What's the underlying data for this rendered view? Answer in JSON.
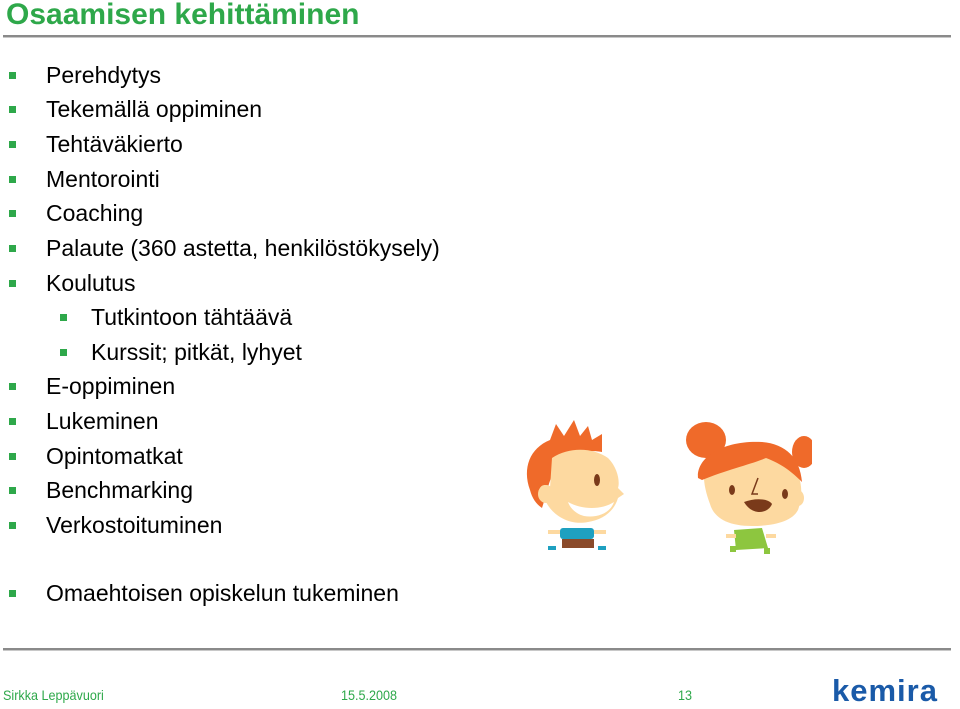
{
  "slide": {
    "title": "Osaamisen kehittäminen",
    "bullets": [
      {
        "text": "Perehdytys",
        "level": 1
      },
      {
        "text": "Tekemällä oppiminen",
        "level": 1
      },
      {
        "text": "Tehtäväkierto",
        "level": 1
      },
      {
        "text": "Mentorointi",
        "level": 1
      },
      {
        "text": "Coaching",
        "level": 1
      },
      {
        "text": "Palaute (360 astetta, henkilöstökysely)",
        "level": 1
      },
      {
        "text": "Koulutus",
        "level": 1
      },
      {
        "text": "Tutkintoon tähtäävä",
        "level": 2
      },
      {
        "text": "Kurssit; pitkät, lyhyet",
        "level": 2
      },
      {
        "text": "E-oppiminen",
        "level": 1
      },
      {
        "text": "Lukeminen",
        "level": 1
      },
      {
        "text": "Opintomatkat",
        "level": 1
      },
      {
        "text": "Benchmarking",
        "level": 1
      },
      {
        "text": "Verkostoituminen",
        "level": 1
      },
      {
        "text": "Omaehtoisen opiskelun tukeminen",
        "level": 1
      }
    ],
    "illustrations": [
      "boy-character",
      "girl-character"
    ]
  },
  "footer": {
    "author": "Sirkka Leppävuori",
    "date": "15.5.2008",
    "page_number": "13",
    "logo_text": "kemira"
  },
  "colors": {
    "accent_green": "#2ea84a",
    "logo_blue": "#1a5aa8",
    "hair_orange": "#ef6a2a",
    "skin": "#fdd9a0"
  }
}
